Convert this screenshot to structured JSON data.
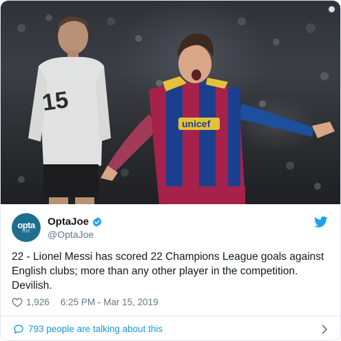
{
  "photo": {
    "alt_text": "",
    "jersey_number": "15",
    "sponsor_text": "unicef"
  },
  "account": {
    "display_name": "OptaJoe",
    "handle": "@OptaJoe",
    "avatar_line1": "opta",
    "avatar_line2": "JOE",
    "verified": true
  },
  "tweet": {
    "text": "22 - Lionel Messi has scored 22 Champions League goals against English clubs; more than any other player in the competition. Devilish.",
    "likes": "1,926",
    "timestamp": "6:25 PM - Mar 15, 2019"
  },
  "footer": {
    "talking_text": "793 people are talking about this"
  },
  "colors": {
    "twitter_blue": "#1da1f2",
    "link_blue": "#1b95e0",
    "muted_text": "#657786",
    "border": "#e1e8ed",
    "avatar_bg": "#1d6e8f"
  },
  "icons": {
    "brand": "twitter-bird-icon",
    "verified": "verified-badge-icon",
    "like": "heart-icon",
    "conversation": "speech-bubble-icon",
    "more": "chevron-right-icon"
  }
}
